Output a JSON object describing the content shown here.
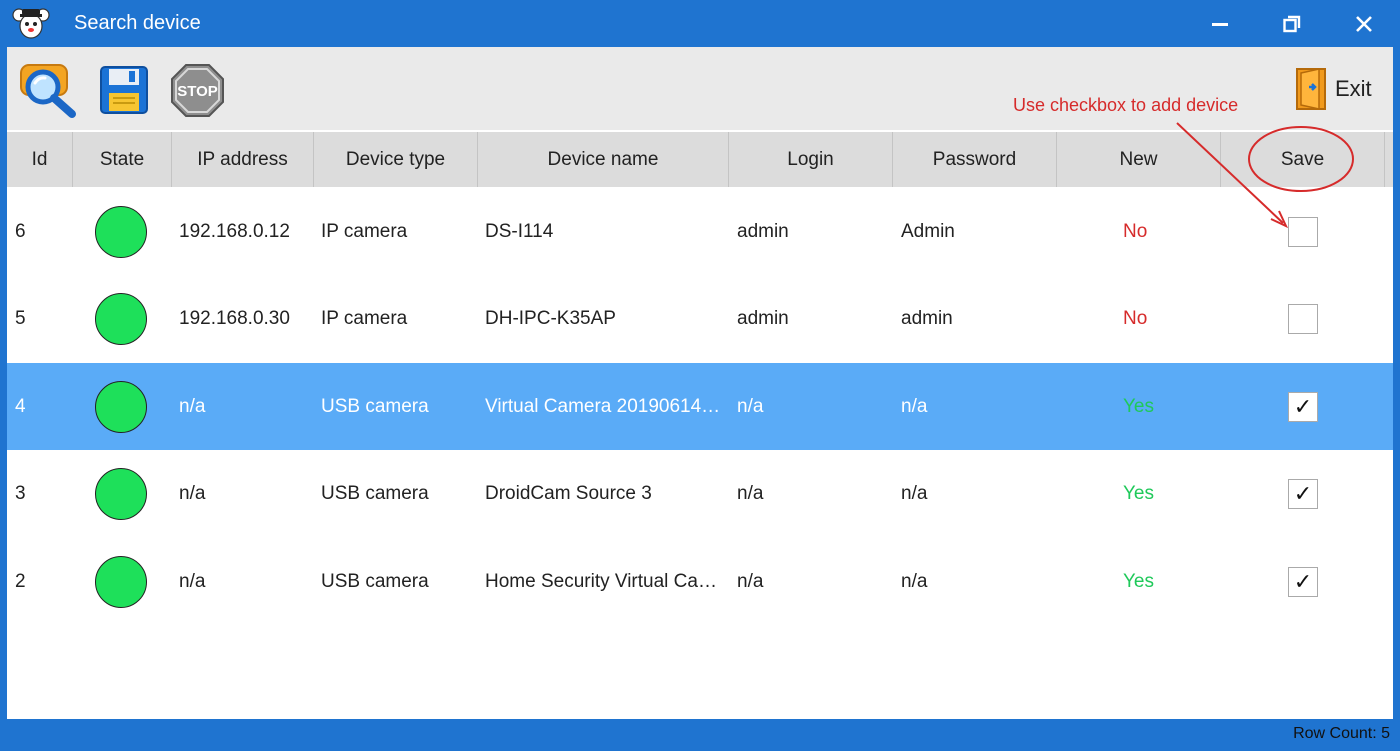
{
  "window": {
    "title": "Search device"
  },
  "toolbar": {
    "exit_label": "Exit"
  },
  "annotation": {
    "text": "Use checkbox to add device"
  },
  "table": {
    "columns": [
      "Id",
      "State",
      "IP address",
      "Device type",
      "Device name",
      "Login",
      "Password",
      "New",
      "Save"
    ],
    "rows": [
      {
        "id": "6",
        "ip": "192.168.0.12",
        "type": "IP camera",
        "name": "DS-I114",
        "login": "admin",
        "password": "Admin",
        "new": "No",
        "save": false
      },
      {
        "id": "5",
        "ip": "192.168.0.30",
        "type": "IP camera",
        "name": "DH-IPC-K35AP",
        "login": "admin",
        "password": "admin",
        "new": "No",
        "save": false
      },
      {
        "id": "4",
        "ip": "n/a",
        "type": "USB camera",
        "name": "Virtual Camera 20190614…",
        "login": "n/a",
        "password": "n/a",
        "new": "Yes",
        "save": true
      },
      {
        "id": "3",
        "ip": "n/a",
        "type": "USB camera",
        "name": "DroidCam Source 3",
        "login": "n/a",
        "password": "n/a",
        "new": "Yes",
        "save": true
      },
      {
        "id": "2",
        "ip": "n/a",
        "type": "USB camera",
        "name": "Home Security Virtual Ca…",
        "login": "n/a",
        "password": "n/a",
        "new": "Yes",
        "save": true
      }
    ],
    "selected_row": 2
  },
  "status": {
    "row_count": "Row Count: 5"
  },
  "icons": {
    "app": "mascot-icon",
    "search": "search-magnifier-icon",
    "save": "floppy-disk-icon",
    "stop": "stop-sign-icon",
    "exit": "door-exit-icon",
    "minimize": "minimize-icon",
    "restore": "restore-icon",
    "close": "close-icon",
    "checkmark": "✓"
  },
  "colors": {
    "accent": "#1f74d0",
    "selection": "#5aabf7",
    "online": "#1ee05a",
    "no": "#d62b2b",
    "yes": "#1fc95a",
    "annotation": "#d62b2b"
  }
}
